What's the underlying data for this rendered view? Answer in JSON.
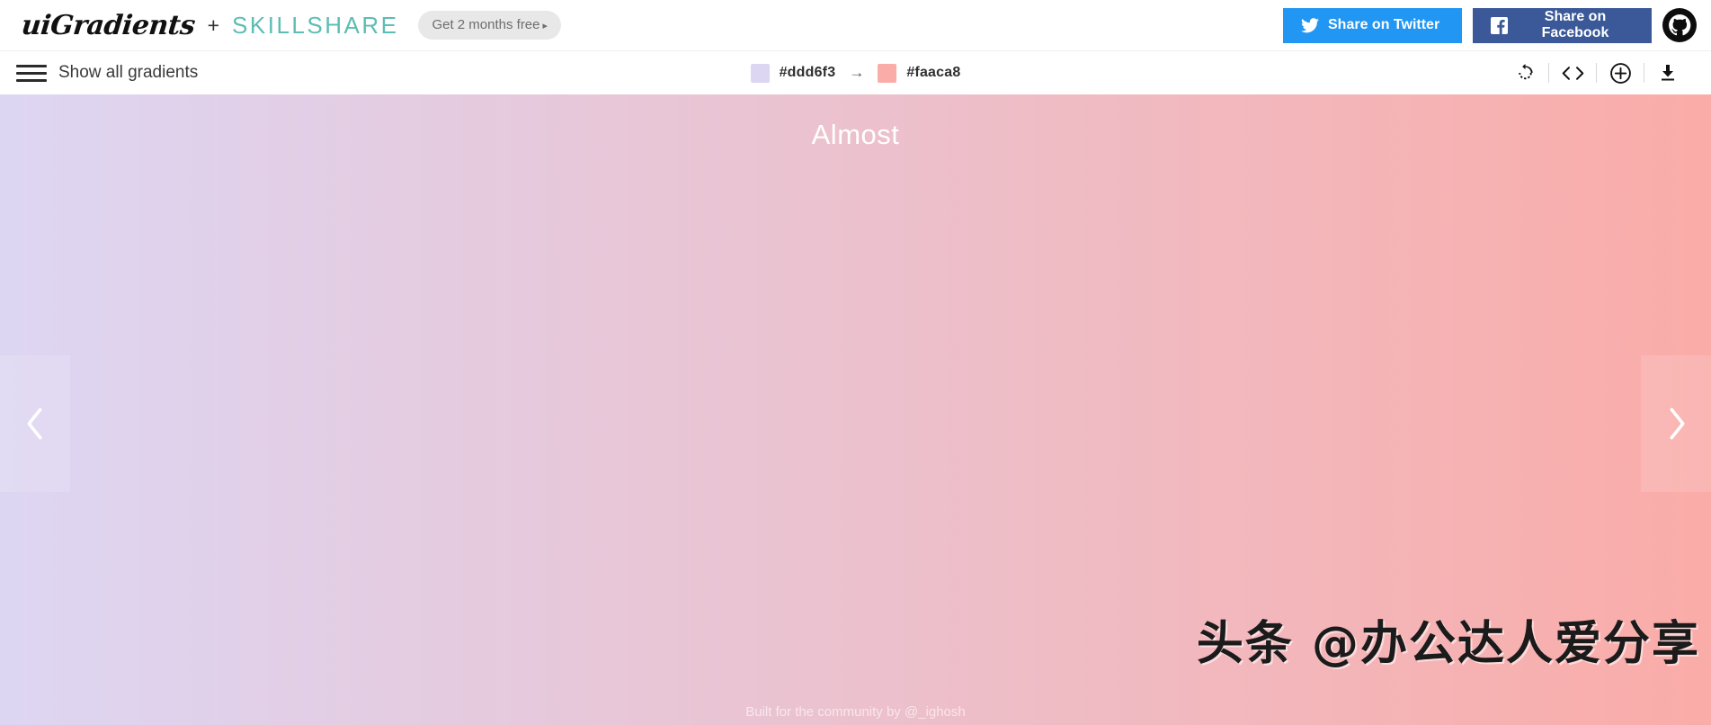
{
  "topbar": {
    "logo_text": "uiGradients",
    "plus": "+",
    "partner": "SKILLSHARE",
    "promo_label": "Get 2 months free",
    "promo_caret": "▸",
    "twitter_label": "Share on Twitter",
    "facebook_label": "Share on Facebook",
    "twitter_color": "#2196f3",
    "facebook_color": "#3b5998",
    "github_icon": "github-icon"
  },
  "subbar": {
    "show_all_label": "Show all gradients",
    "menu_icon": "hamburger-icon",
    "arrow_symbol": "→",
    "colors": [
      {
        "hex": "#ddd6f3",
        "label": "#ddd6f3"
      },
      {
        "hex": "#faaca8",
        "label": "#faaca8"
      }
    ],
    "tools": [
      {
        "name": "rotate-icon"
      },
      {
        "name": "code-icon"
      },
      {
        "name": "add-icon"
      },
      {
        "name": "download-icon"
      }
    ]
  },
  "canvas": {
    "gradient_name": "Almost",
    "start_color": "#ddd6f3",
    "end_color": "#faaca8",
    "footer_credit": "Built for the community by @_ighosh",
    "prev_icon": "chevron-left-icon",
    "next_icon": "chevron-right-icon"
  },
  "watermark": {
    "text": "头条 @办公达人爱分享"
  }
}
